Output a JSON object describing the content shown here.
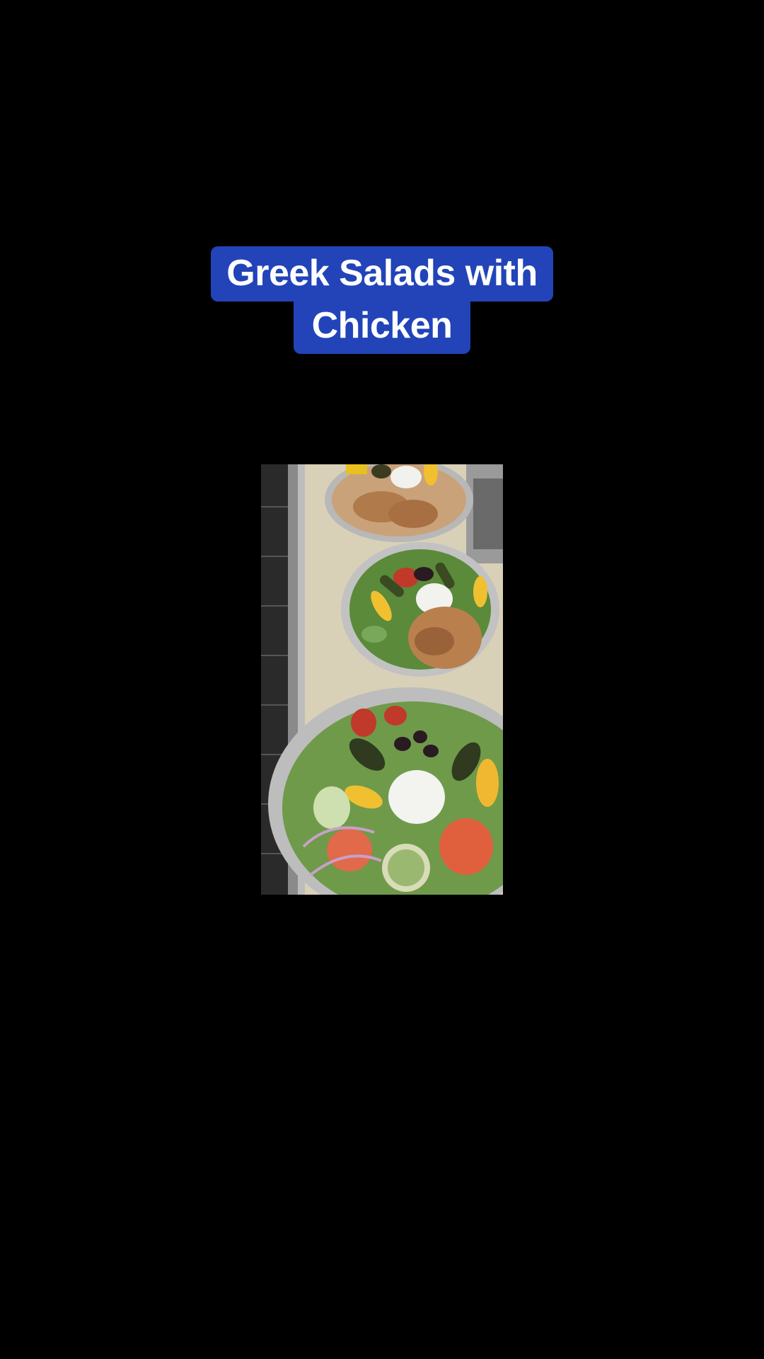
{
  "caption": {
    "line1": "Greek Salads with",
    "line2": "Chicken",
    "background_color": "#2244b8",
    "text_color": "#ffffff"
  },
  "photo": {
    "subject": "Three foil trays of Greek salad with grilled chicken, feta, stuffed grape leaves, olives, peppers, tomato and cucumber on a counter"
  },
  "page": {
    "background_color": "#000000"
  }
}
